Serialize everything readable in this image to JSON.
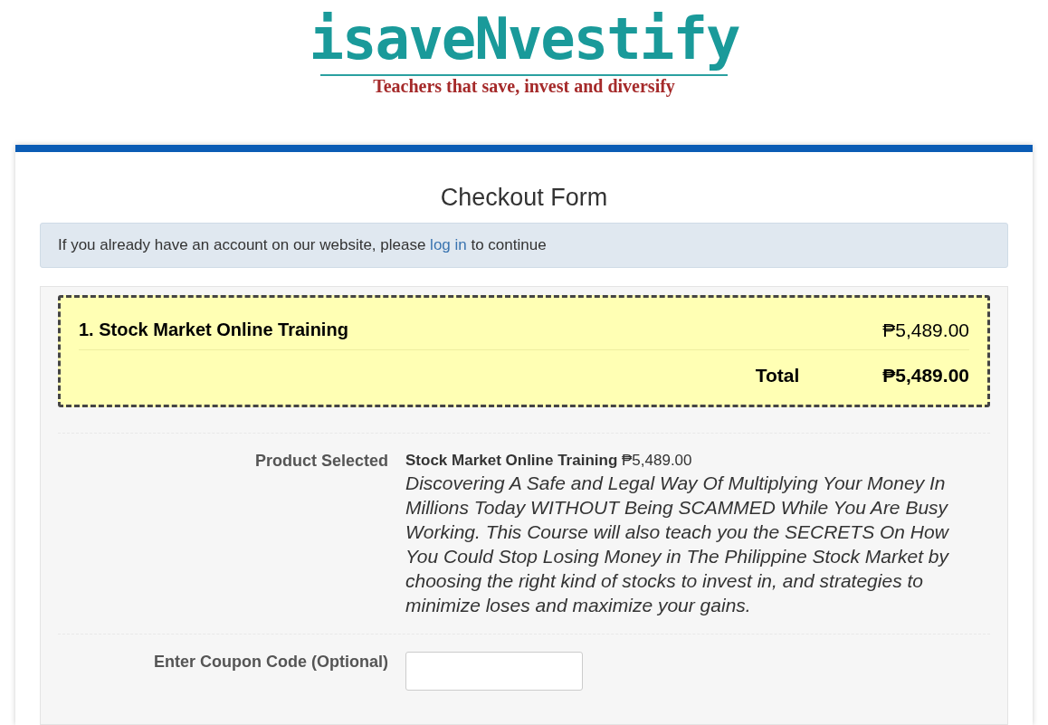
{
  "logo": {
    "name": "isaveNvestify",
    "tagline": "Teachers that save, invest and diversify"
  },
  "form_title": "Checkout Form",
  "notice": {
    "before": "If you already have an account on our website, please ",
    "link": "log in",
    "after": " to continue"
  },
  "order": {
    "items": [
      {
        "name": "1. Stock Market Online Training",
        "price": "₱5,489.00"
      }
    ],
    "total_label": "Total",
    "total": "₱5,489.00"
  },
  "fields": [
    {
      "kind": "product",
      "label": "Product Selected",
      "value": "**Stock Market Online Training** ₱5,489.00",
      "description": "Discovering A Safe and Legal Way Of Multiplying Your Money In Millions Today WITHOUT Being SCAMMED While You Are Busy Working. This Course will also teach you the SECRETS On How You Could Stop Losing Money in The Philippine Stock Market by choosing the right kind of stocks to invest in, and strategies to minimize loses and maximize your gains."
    },
    {
      "kind": "input",
      "label": "Enter Coupon Code (Optional)"
    }
  ]
}
